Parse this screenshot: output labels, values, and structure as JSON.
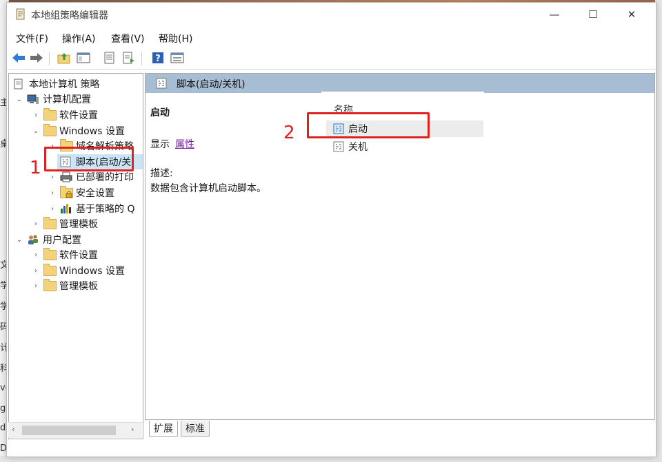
{
  "window": {
    "title": "本地组策略编辑器"
  },
  "title_buttons": {
    "minimize": "—",
    "maximize": "☐",
    "close": "✕"
  },
  "menu": [
    "文件(F)",
    "操作(A)",
    "查看(V)",
    "帮助(H)"
  ],
  "toolbar": [
    "back-icon",
    "forward-icon",
    "up-folder-icon",
    "show-hide-tree-icon",
    "properties-icon",
    "export-list-icon",
    "help-icon",
    "show-view-icon"
  ],
  "tree": {
    "root": "本地计算机 策略",
    "computer_config": "计算机配置",
    "software_settings": "软件设置",
    "windows_settings": "Windows 设置",
    "name_resolution": "域名解析策略",
    "scripts": "脚本(启动/关",
    "deployed_printers": "已部署的打印",
    "security_settings": "安全设置",
    "policy_qos": "基于策略的 Q",
    "admin_templates": "管理模板",
    "user_config": "用户配置",
    "user_software": "软件设置",
    "user_windows": "Windows 设置",
    "user_admin": "管理模板"
  },
  "detail": {
    "header": "脚本(启动/关机)",
    "item_title": "启动",
    "show_label": "显示",
    "properties_link": "属性",
    "desc_label": "描述:",
    "desc_text": "数据包含计算机启动脚本。"
  },
  "list": {
    "column_name": "名称",
    "items": [
      "启动",
      "关机"
    ]
  },
  "tabs": [
    "扩展",
    "标准"
  ],
  "annotations": [
    "1",
    "2"
  ],
  "background_chars": [
    "主",
    "桌",
    "文",
    "学",
    "学",
    "码",
    "计",
    "科",
    "vc",
    "g",
    "d5",
    "D"
  ],
  "colors": {
    "accent_red": "#e02020",
    "header_blue": "#a7bdd4",
    "selection": "#cce4f7"
  }
}
